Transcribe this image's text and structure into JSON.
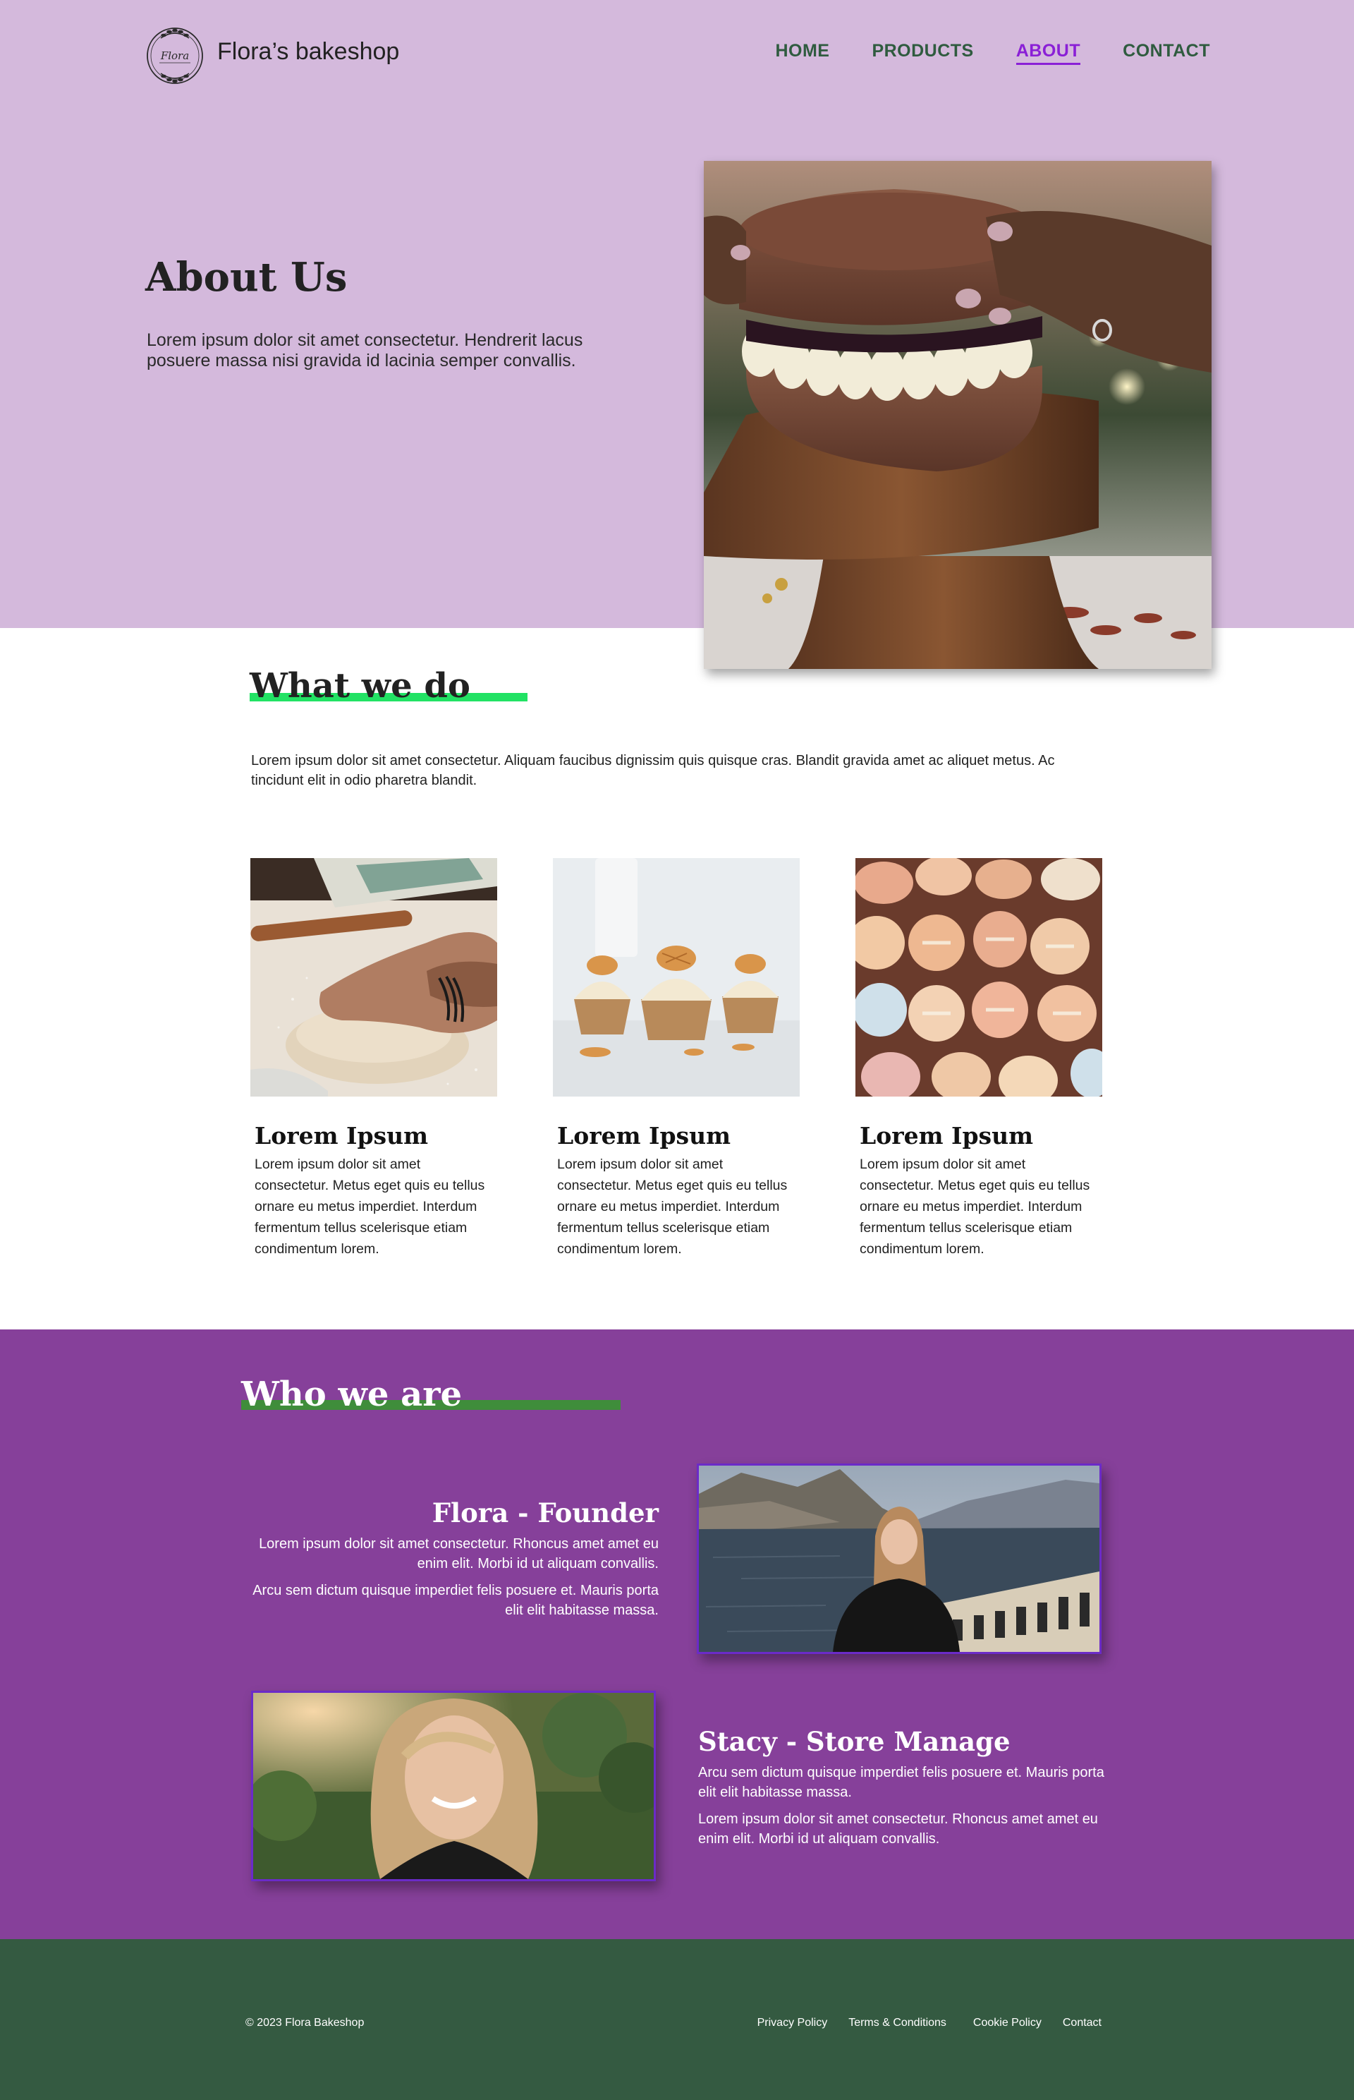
{
  "header": {
    "logo_text": "Flora",
    "brand": "Flora’s bakeshop",
    "nav": [
      {
        "label": "HOME",
        "active": false
      },
      {
        "label": "PRODUCTS",
        "active": false
      },
      {
        "label": "ABOUT",
        "active": true
      },
      {
        "label": "CONTACT",
        "active": false
      }
    ]
  },
  "hero": {
    "title": "About Us",
    "text": "Lorem ipsum dolor sit amet consectetur. Hendrerit lacus posuere massa nisi gravida id lacinia semper convallis.",
    "image": "cake-on-stand-photo"
  },
  "what_we_do": {
    "title": "What we do",
    "text": "Lorem ipsum dolor sit amet consectetur. Aliquam faucibus dignissim quis quisque cras. Blandit gravida amet ac aliquet metus. Ac tincidunt elit in odio pharetra blandit.",
    "cards": [
      {
        "image": "kneading-dough-photo",
        "title": "Lorem Ipsum",
        "text": "Lorem ipsum dolor sit amet consectetur. Metus eget quis eu tellus ornare eu metus imperdiet. Interdum fermentum tellus scelerisque etiam condimentum lorem."
      },
      {
        "image": "cupcakes-photo",
        "title": "Lorem Ipsum",
        "text": "Lorem ipsum dolor sit amet consectetur. Metus eget quis eu tellus ornare eu metus imperdiet. Interdum fermentum tellus scelerisque etiam condimentum lorem."
      },
      {
        "image": "macarons-photo",
        "title": "Lorem Ipsum",
        "text": "Lorem ipsum dolor sit amet consectetur. Metus eget quis eu tellus ornare eu metus imperdiet. Interdum fermentum tellus scelerisque etiam condimentum lorem."
      }
    ]
  },
  "who_we_are": {
    "title": "Who we are",
    "people": [
      {
        "name": "Flora - Founder",
        "paragraphs": [
          "Lorem ipsum dolor sit amet consectetur. Rhoncus amet amet eu enim elit. Morbi id ut aliquam convallis.",
          "Arcu sem dictum quisque imperdiet felis posuere et. Mauris porta elit elit habitasse massa."
        ],
        "image": "founder-lake-photo"
      },
      {
        "name": "Stacy - Store Manage",
        "paragraphs": [
          "Arcu sem dictum quisque imperdiet felis posuere et. Mauris porta elit elit habitasse massa.",
          "Lorem ipsum dolor sit amet consectetur. Rhoncus amet amet eu enim elit. Morbi id ut aliquam convallis."
        ],
        "image": "manager-portrait-photo"
      }
    ]
  },
  "footer": {
    "copyright": "© 2023 Flora Bakeshop",
    "links": [
      "Privacy Policy",
      "Terms & Conditions",
      "Cookie Policy",
      "Contact"
    ]
  },
  "colors": {
    "hero_bg": "#d4b9dc",
    "nav_text": "#2f5b3f",
    "nav_active": "#8a1fd6",
    "accent_green": "#22e264",
    "who_bg": "#86409a",
    "who_bar": "#3f8d3b",
    "footer_bg": "#345a41"
  }
}
